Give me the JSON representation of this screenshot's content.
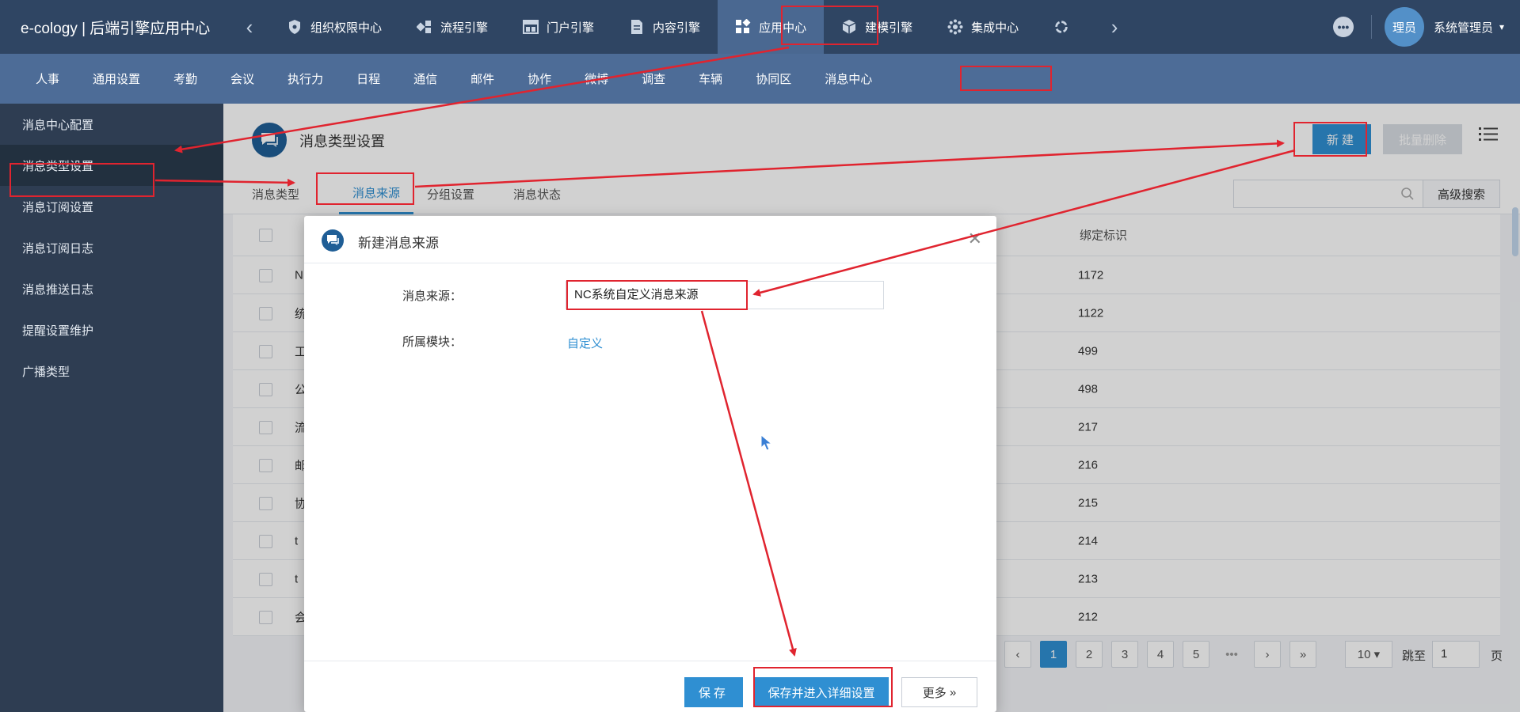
{
  "app": {
    "brand": "e-cology | 后端引擎应用中心"
  },
  "topnav": {
    "items": [
      {
        "label": "组织权限中心",
        "icon": "shield-icon"
      },
      {
        "label": "流程引擎",
        "icon": "flow-icon"
      },
      {
        "label": "门户引擎",
        "icon": "portal-icon"
      },
      {
        "label": "内容引擎",
        "icon": "document-icon"
      },
      {
        "label": "应用中心",
        "icon": "apps-icon",
        "active": true
      },
      {
        "label": "建模引擎",
        "icon": "cube-icon"
      },
      {
        "label": "集成中心",
        "icon": "integration-icon"
      }
    ]
  },
  "user": {
    "avatar_text": "理员",
    "name": "系统管理员"
  },
  "subnav": {
    "items": [
      "人事",
      "通用设置",
      "考勤",
      "会议",
      "执行力",
      "日程",
      "通信",
      "邮件",
      "协作",
      "微博",
      "调查",
      "车辆",
      "协同区",
      "消息中心"
    ]
  },
  "sidebar": {
    "items": [
      {
        "label": "消息中心配置"
      },
      {
        "label": "消息类型设置",
        "active": true
      },
      {
        "label": "消息订阅设置"
      },
      {
        "label": "消息订阅日志"
      },
      {
        "label": "消息推送日志"
      },
      {
        "label": "提醒设置维护"
      },
      {
        "label": "广播类型"
      }
    ]
  },
  "main": {
    "title": "消息类型设置",
    "new_button": "新建",
    "batch_delete_button": "批量删除",
    "tabs": [
      "消息类型",
      "消息来源",
      "分组设置",
      "消息状态"
    ],
    "active_tab": "消息来源",
    "advanced_search": "高级搜索",
    "column_header": "绑定标识",
    "rows": [
      {
        "first": "N",
        "binding": "1172"
      },
      {
        "first": "统",
        "binding": "1122"
      },
      {
        "first": "工",
        "binding": "499"
      },
      {
        "first": "公",
        "binding": "498"
      },
      {
        "first": "流",
        "binding": "217"
      },
      {
        "first": "邮",
        "binding": "216"
      },
      {
        "first": "协",
        "binding": "215"
      },
      {
        "first": "t",
        "binding": "214"
      },
      {
        "first": "t",
        "binding": "213"
      },
      {
        "first": "会",
        "binding": "212"
      }
    ],
    "pagination": {
      "pages": [
        "1",
        "2",
        "3",
        "4",
        "5"
      ],
      "current": "1",
      "ellipsis": "•••",
      "page_size": "10",
      "jump_label": "跳至",
      "jump_value": "1",
      "page_suffix": "页"
    }
  },
  "dialog": {
    "title": "新建消息来源",
    "fields": [
      {
        "label": "消息来源：",
        "value": "NC系统自定义消息来源"
      },
      {
        "label": "所属模块：",
        "value": "自定义"
      }
    ],
    "save_button": "保存",
    "save_detail_button": "保存并进入详细设置",
    "more_button": "更多"
  },
  "colors": {
    "topbar": "#2f4563",
    "subbar": "#4d6c97",
    "sidebar": "#2e3d52",
    "accent": "#2f8fd2",
    "annotation": "#e0242f"
  }
}
